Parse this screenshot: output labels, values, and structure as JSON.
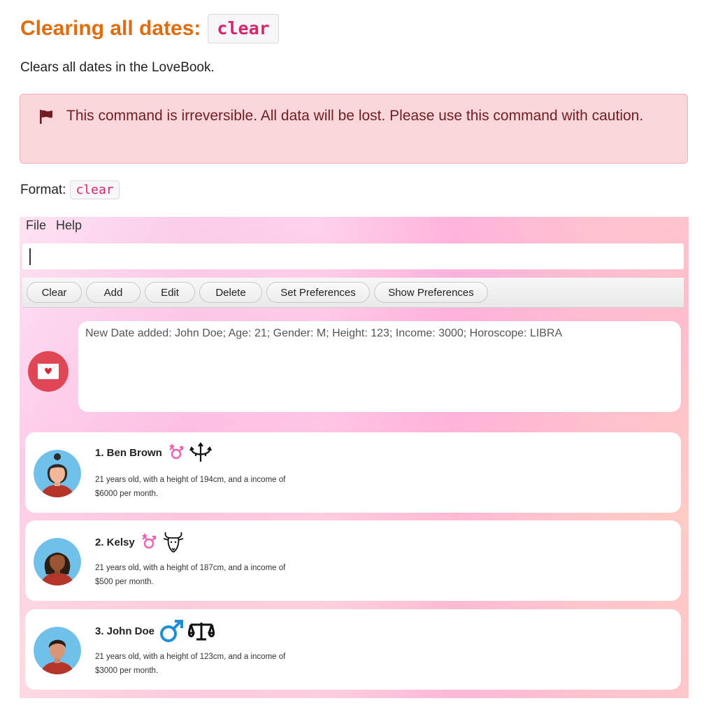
{
  "heading": {
    "title": "Clearing all dates:",
    "code": "clear"
  },
  "description": "Clears all dates in the LoveBook.",
  "alert": {
    "text": "This command is irreversible. All data will be lost. Please use this command with caution."
  },
  "format": {
    "label": "Format:",
    "code": "clear"
  },
  "app": {
    "menu": [
      "File",
      "Help"
    ],
    "command_input": {
      "value": ""
    },
    "buttons": [
      "Clear",
      "Add",
      "Edit",
      "Delete",
      "Set Preferences",
      "Show Preferences"
    ],
    "result": "New Date added: John Doe; Age: 21; Gender: M; Height: 123; Income: 3000; Horoscope: LIBRA",
    "dates": [
      {
        "name": "1.  Ben Brown",
        "gender_icon": "other-gender-icon",
        "horoscope_icon": "pisces-icon",
        "line1": "21 years old, with a height of 194cm, and a income of",
        "line2": "$6000 per month."
      },
      {
        "name": "2.  Kelsy",
        "gender_icon": "other-gender-icon",
        "horoscope_icon": "capricorn-icon",
        "line1": "21 years old, with a height of 187cm, and a income of",
        "line2": "$500 per month."
      },
      {
        "name": "3.  John Doe",
        "gender_icon": "male-icon",
        "horoscope_icon": "libra-icon",
        "line1": "21 years old, with a height of 123cm, and a income of",
        "line2": "$3000 per month."
      }
    ]
  },
  "colors": {
    "heading": "#e06c0e",
    "code": "#d6246e",
    "alert_bg": "#f8d7da",
    "alert_text": "#721c24",
    "mail_badge": "#e04756"
  }
}
